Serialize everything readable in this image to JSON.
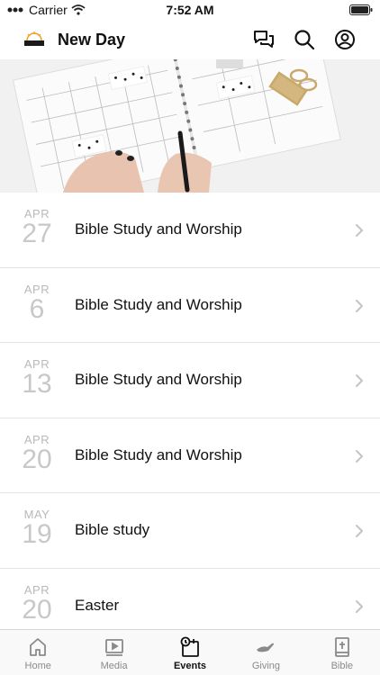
{
  "status_bar": {
    "carrier": "Carrier",
    "time": "7:52 AM"
  },
  "header": {
    "title": "New Day",
    "logo_text": "New Day"
  },
  "events": [
    {
      "month": "APR",
      "day": "27",
      "title": "Bible Study and Worship"
    },
    {
      "month": "APR",
      "day": "6",
      "title": "Bible Study and Worship"
    },
    {
      "month": "APR",
      "day": "13",
      "title": "Bible Study and Worship"
    },
    {
      "month": "APR",
      "day": "20",
      "title": "Bible Study and Worship"
    },
    {
      "month": "MAY",
      "day": "19",
      "title": "Bible study"
    },
    {
      "month": "APR",
      "day": "20",
      "title": "Easter"
    }
  ],
  "tabs": [
    {
      "label": "Home",
      "icon": "home-icon",
      "active": false
    },
    {
      "label": "Media",
      "icon": "media-icon",
      "active": false
    },
    {
      "label": "Events",
      "icon": "events-icon",
      "active": true
    },
    {
      "label": "Giving",
      "icon": "giving-icon",
      "active": false
    },
    {
      "label": "Bible",
      "icon": "bible-icon",
      "active": false
    }
  ],
  "colors": {
    "accent": "#111111",
    "inactive": "#8a8a8a",
    "date": "#c8c8c8",
    "divider": "#e3e3e3"
  }
}
